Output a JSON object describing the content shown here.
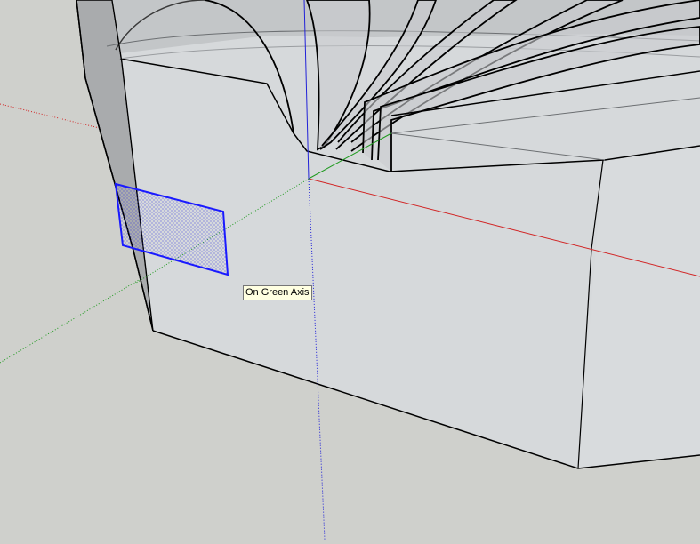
{
  "tooltip": {
    "text": "On Green Axis"
  },
  "colors": {
    "background": "#cfd0cc",
    "face": "#d6d9db",
    "face_shadow": "#a9abad",
    "red_axis": "#d12424",
    "green_axis": "#1f9a1f",
    "blue_axis": "#2222d8",
    "selection": "#1a1aff",
    "edge": "#000000"
  }
}
